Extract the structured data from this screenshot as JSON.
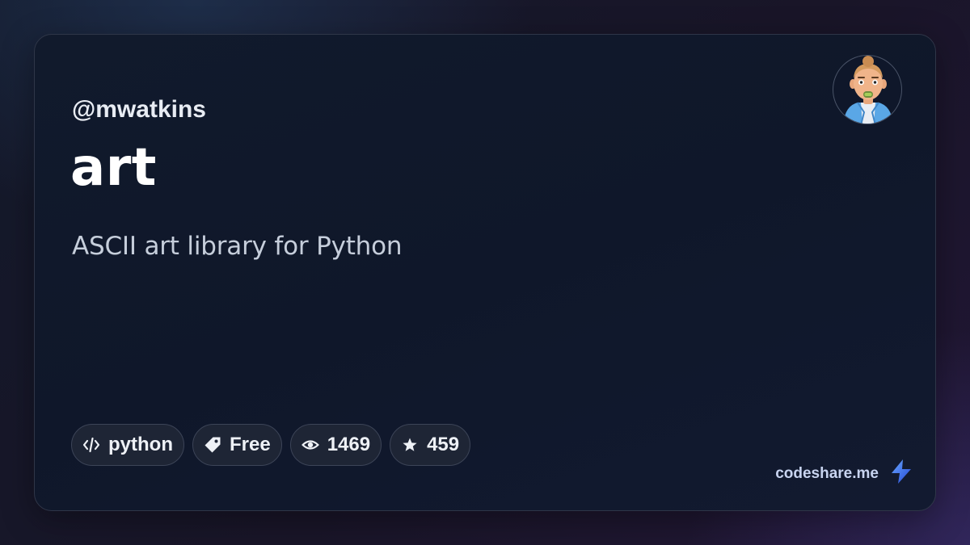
{
  "card": {
    "username": "@mwatkins",
    "title": "art",
    "description": "ASCII art library for Python",
    "avatar_icon": "avatar-icon",
    "tags": [
      {
        "icon": "code-icon",
        "label": "python"
      },
      {
        "icon": "tag-icon",
        "label": "Free"
      },
      {
        "icon": "eye-icon",
        "label": "1469"
      },
      {
        "icon": "star-icon",
        "label": "459"
      }
    ],
    "brand": {
      "text": "codeshare.me",
      "icon": "bolt-icon"
    }
  },
  "colors": {
    "background": "#141a2b",
    "card": "#0f172a",
    "tag_bg": "#1e2535",
    "brand_accent": "#3b6cf0"
  }
}
